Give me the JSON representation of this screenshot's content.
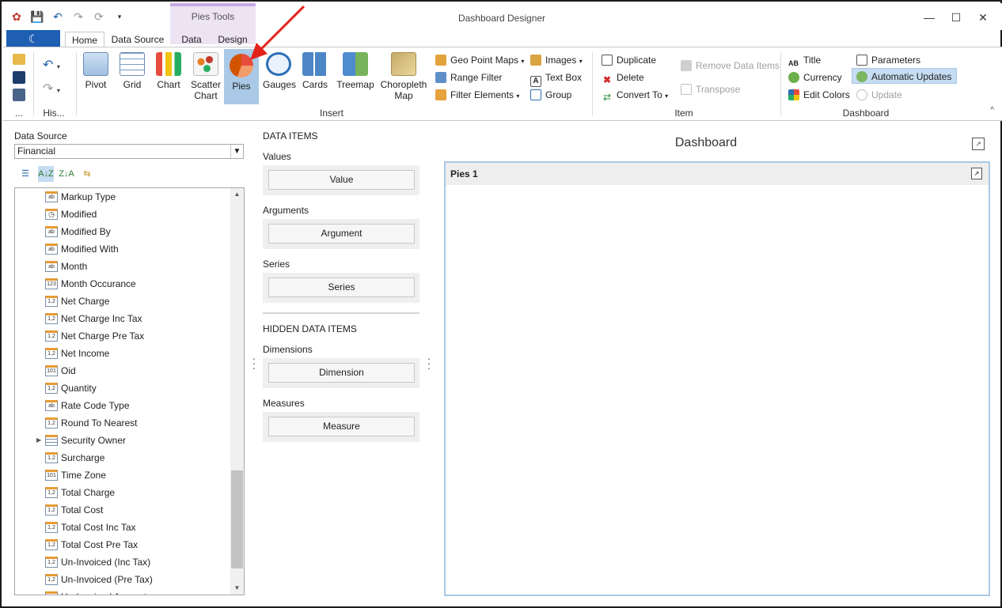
{
  "window": {
    "title": "Dashboard Designer",
    "context_tab": "Pies Tools"
  },
  "tabs": [
    {
      "label": "Home",
      "active": true
    },
    {
      "label": "Data Source",
      "active": false
    },
    {
      "label": "Data",
      "active": false
    },
    {
      "label": "Design",
      "active": false
    }
  ],
  "ribbon": {
    "history_label": "His...",
    "more_label": "...",
    "insert": {
      "group_label": "Insert",
      "large": [
        {
          "label": "Pivot"
        },
        {
          "label": "Grid"
        },
        {
          "label": "Chart"
        },
        {
          "label": "Scatter Chart"
        },
        {
          "label": "Pies"
        },
        {
          "label": "Gauges"
        },
        {
          "label": "Cards"
        },
        {
          "label": "Treemap"
        },
        {
          "label": "Choropleth Map"
        }
      ],
      "small": [
        {
          "label": "Geo Point Maps"
        },
        {
          "label": "Range Filter"
        },
        {
          "label": "Filter Elements"
        },
        {
          "label": "Images"
        },
        {
          "label": "Text Box"
        },
        {
          "label": "Group"
        }
      ]
    },
    "item": {
      "group_label": "Item",
      "buttons": [
        {
          "label": "Duplicate"
        },
        {
          "label": "Delete"
        },
        {
          "label": "Convert To"
        },
        {
          "label": "Remove Data Items"
        },
        {
          "label": "Transpose"
        }
      ]
    },
    "dashboard": {
      "group_label": "Dashboard",
      "buttons": [
        {
          "label": "Title"
        },
        {
          "label": "Currency"
        },
        {
          "label": "Edit Colors"
        },
        {
          "label": "Parameters"
        },
        {
          "label": "Automatic Updates"
        },
        {
          "label": "Update"
        }
      ]
    }
  },
  "data_source": {
    "label": "Data Source",
    "selected": "Financial",
    "fields": [
      {
        "name": "Markup Type",
        "type": "ab"
      },
      {
        "name": "Modified",
        "type": "time"
      },
      {
        "name": "Modified By",
        "type": "ab"
      },
      {
        "name": "Modified With",
        "type": "ab"
      },
      {
        "name": "Month",
        "type": "ab"
      },
      {
        "name": "Month Occurance",
        "type": "123"
      },
      {
        "name": "Net Charge",
        "type": "1,2"
      },
      {
        "name": "Net Charge Inc Tax",
        "type": "1,2"
      },
      {
        "name": "Net Charge Pre Tax",
        "type": "1,2"
      },
      {
        "name": "Net Income",
        "type": "1,2"
      },
      {
        "name": "Oid",
        "type": "101"
      },
      {
        "name": "Quantity",
        "type": "1,2"
      },
      {
        "name": "Rate Code Type",
        "type": "ab"
      },
      {
        "name": "Round To Nearest",
        "type": "1,2"
      },
      {
        "name": "Security Owner",
        "type": "table"
      },
      {
        "name": "Surcharge",
        "type": "1,2"
      },
      {
        "name": "Time Zone",
        "type": "101"
      },
      {
        "name": "Total Charge",
        "type": "1,2"
      },
      {
        "name": "Total Cost",
        "type": "1,2"
      },
      {
        "name": "Total Cost Inc Tax",
        "type": "1,2"
      },
      {
        "name": "Total Cost Pre Tax",
        "type": "1,2"
      },
      {
        "name": "Un-Invoiced (Inc Tax)",
        "type": "1,2"
      },
      {
        "name": "Un-Invoiced (Pre Tax)",
        "type": "1,2"
      },
      {
        "name": "Un-Invoiced Amount",
        "type": "1,2"
      }
    ]
  },
  "data_items": {
    "heading": "DATA ITEMS",
    "values": {
      "label": "Values",
      "button": "Value"
    },
    "arguments": {
      "label": "Arguments",
      "button": "Argument"
    },
    "series": {
      "label": "Series",
      "button": "Series"
    },
    "hidden_heading": "HIDDEN DATA ITEMS",
    "dimensions": {
      "label": "Dimensions",
      "button": "Dimension"
    },
    "measures": {
      "label": "Measures",
      "button": "Measure"
    }
  },
  "dashboard": {
    "title": "Dashboard",
    "item_caption": "Pies 1"
  },
  "colors": {
    "accent": "#1e5fb3",
    "selected": "#a9c9e6",
    "context_tab": "#ece3f3",
    "annotation": "#e3221b"
  }
}
